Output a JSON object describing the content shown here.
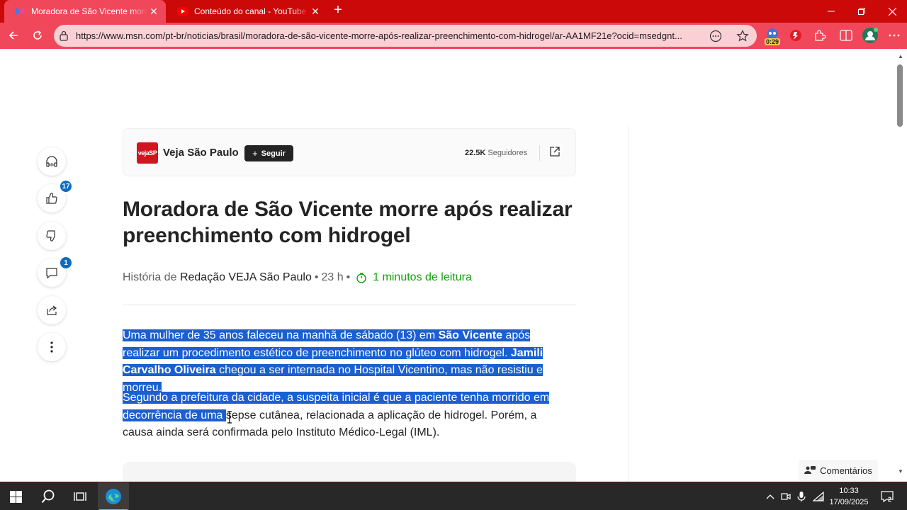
{
  "browser": {
    "tabs": [
      {
        "title": "Moradora de São Vicente morre após realizar",
        "active": true,
        "favicon": "msn-butterfly-icon"
      },
      {
        "title": "Conteúdo do canal - YouTube Studio",
        "active": false,
        "favicon": "youtube-icon"
      }
    ],
    "url": "https://www.msn.com/pt-br/noticias/brasil/moradora-de-são-vicente-morre-após-realizar-preenchimento-com-hidrogel/ar-AA1MF21e?ocid=msedgnt...",
    "extension_badge": "0:29",
    "accent_color": "#cc0909",
    "toolbar_color": "#f0485a"
  },
  "publisher": {
    "logo_text": "vejaSP",
    "name": "Veja São Paulo",
    "follow_label": "Seguir",
    "followers_count": "22.5K",
    "followers_label": "Seguidores"
  },
  "rail": {
    "likes_badge": "17",
    "comments_badge": "1"
  },
  "article": {
    "headline": "Moradora de São Vicente morre após realizar preenchimento com hidrogel",
    "byline_prefix": "História de",
    "author": "Redação VEJA São Paulo",
    "age": "23 h",
    "read_time": "1 minutos de leitura",
    "p1": {
      "t1": "Uma mulher de 35 anos faleceu na manhã de sábado (13) em ",
      "b1": "São Vicente",
      "t2": " após realizar um procedimento estético de preenchimento no glúteo com hidrogel. ",
      "b2": "Jamili Carvalho Oliveira",
      "t3": " chegou a ser internada no Hospital Vicentino, mas não resistiu e morreu."
    },
    "p2": {
      "selected": "Segundo a prefeitura da cidade, a suspeita inicial é que a paciente tenha morrido em decorrência de uma ",
      "rest": "sepse cutânea, relacionada a aplicação de hidrogel. Porém, a causa ainda será confirmada pelo Instituto Médico-Legal (IML)."
    },
    "selection_color": "#1b5fd0"
  },
  "comments_button": "Comentários",
  "taskbar": {
    "time": "10:33",
    "date": "17/09/2025",
    "notif_count": "2"
  }
}
